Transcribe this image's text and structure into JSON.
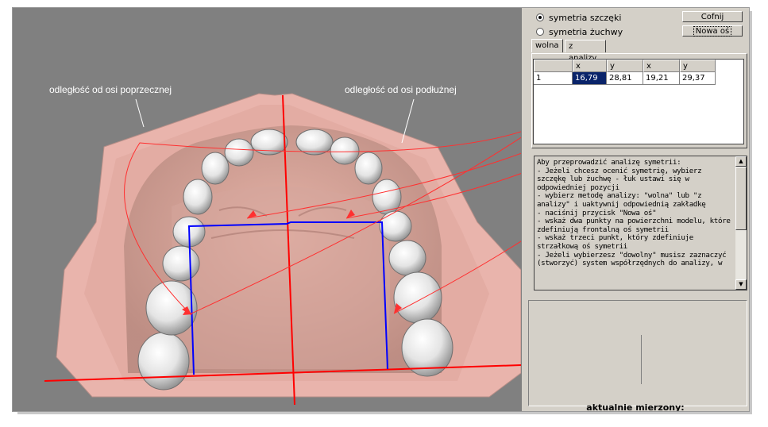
{
  "viewport": {
    "label_transverse": "odległość od osi poprzecznej",
    "label_longitudinal": "odległość od osi podłużnej",
    "colors": {
      "background": "#808080",
      "gum": "#e9b4ac",
      "axis": "#ff0000",
      "measure": "#0000ff"
    }
  },
  "panel": {
    "radio_maxilla": "symetria szczęki",
    "radio_mandible": "symetria żuchwy",
    "selected_radio": "radio_maxilla",
    "undo_button": "Cofnij",
    "new_axis_button": "Nowa oś",
    "tabs": [
      "wolna",
      "z analizy"
    ],
    "active_tab": "wolna",
    "table": {
      "headers": [
        "",
        "x",
        "y",
        "x",
        "y"
      ],
      "rows": [
        [
          "1",
          "16,79",
          "28,81",
          "19,21",
          "29,37"
        ]
      ]
    },
    "instructions": "Aby przeprowadzić analizę symetrii:\n- Jeżeli chcesz ocenić symetrię, wybierz szczękę lub żuchwę - łuk ustawi się w odpowiedniej pozycji\n- wybierz metodę analizy: \"wolna\" lub \"z analizy\" i uaktywnij odpowiednią zakładkę\n- naciśnij przycisk \"Nowa oś\"\n- wskaż dwa punkty na powierzchni modelu, które zdefiniują frontalną oś symetrii\n- wskaż trzeci punkt, który zdefiniuje strzałkową oś symetrii\n- Jeżeli wybierzesz \"dowolny\" musisz zaznaczyć (stworzyć) system współrzędnych do analizy, w",
    "measured_label": "aktualnie mierzony:"
  }
}
